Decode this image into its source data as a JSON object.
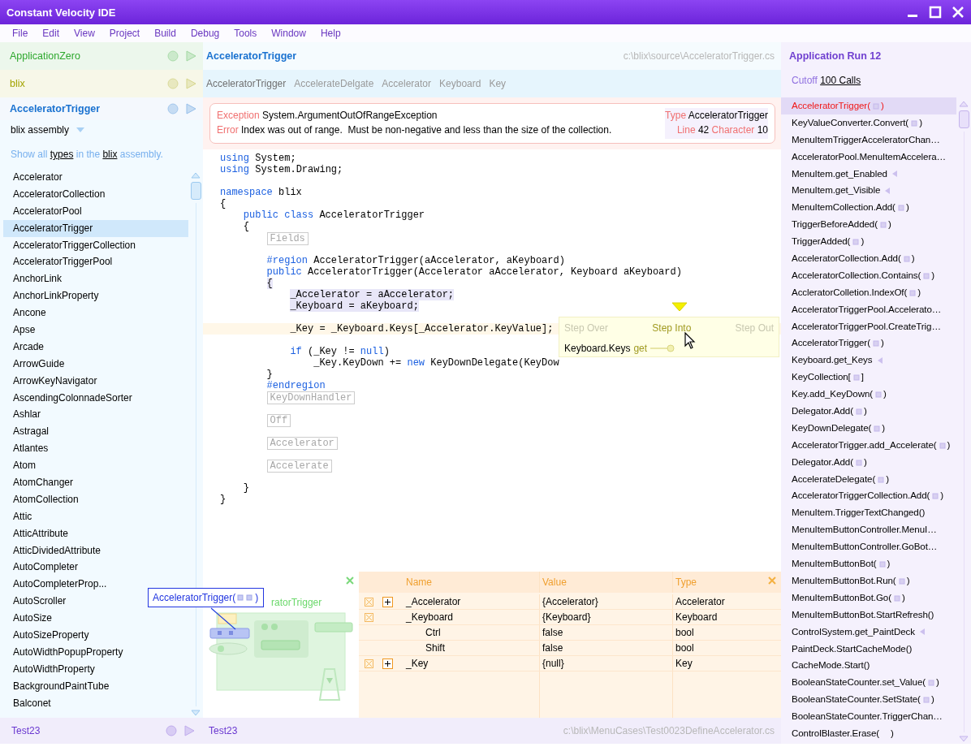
{
  "window": {
    "title": "Constant Velocity IDE"
  },
  "menu": [
    "File",
    "Edit",
    "View",
    "Project",
    "Build",
    "Debug",
    "Tools",
    "Window",
    "Help"
  ],
  "projects": [
    {
      "name": "ApplicationZero",
      "color": "#2ea82e",
      "selected": false
    },
    {
      "name": "blix",
      "color": "#a3a300",
      "selected": false
    },
    {
      "name": "AcceleratorTrigger",
      "color": "#1a72d0",
      "selected": true
    }
  ],
  "assembly": {
    "label": "blix assembly"
  },
  "assembly_hint": [
    {
      "text": "Show all "
    },
    {
      "text": "types",
      "link": true
    },
    {
      "text": " in the "
    },
    {
      "text": "blix",
      "link": true
    },
    {
      "text": " assembly."
    }
  ],
  "types": [
    {
      "name": "Accelerator",
      "selected": false
    },
    {
      "name": "AcceleratorCollection",
      "selected": false
    },
    {
      "name": "AcceleratorPool",
      "selected": false
    },
    {
      "name": "AcceleratorTrigger",
      "selected": true
    },
    {
      "name": "AcceleratorTriggerCollection",
      "selected": false
    },
    {
      "name": "AcceleratorTriggerPool",
      "selected": false
    },
    {
      "name": "AnchorLink",
      "selected": false
    },
    {
      "name": "AnchorLinkProperty",
      "selected": false
    },
    {
      "name": "Ancone",
      "selected": false
    },
    {
      "name": "Apse",
      "selected": false
    },
    {
      "name": "Arcade",
      "selected": false
    },
    {
      "name": "ArrowGuide",
      "selected": false
    },
    {
      "name": "ArrowKeyNavigator",
      "selected": false
    },
    {
      "name": "AscendingColonnadeSorter",
      "selected": false
    },
    {
      "name": "Ashlar",
      "selected": false
    },
    {
      "name": "Astragal",
      "selected": false
    },
    {
      "name": "Atlantes",
      "selected": false
    },
    {
      "name": "Atom",
      "selected": false
    },
    {
      "name": "AtomChanger",
      "selected": false
    },
    {
      "name": "AtomCollection",
      "selected": false
    },
    {
      "name": "Attic",
      "selected": false
    },
    {
      "name": "AtticAttribute",
      "selected": false
    },
    {
      "name": "AtticDividedAttribute",
      "selected": false
    },
    {
      "name": "AutoCompleter",
      "selected": false
    },
    {
      "name": "AutoCompleterProp...",
      "selected": false
    },
    {
      "name": "AutoScroller",
      "selected": false
    },
    {
      "name": "AutoSize",
      "selected": false
    },
    {
      "name": "AutoSizeProperty",
      "selected": false
    },
    {
      "name": "AutoWidthPopupProperty",
      "selected": false
    },
    {
      "name": "AutoWidthProperty",
      "selected": false
    },
    {
      "name": "BackgroundPaintTube",
      "selected": false
    },
    {
      "name": "Balconet",
      "selected": false
    }
  ],
  "left_footer": {
    "name": "Test23"
  },
  "editor": {
    "title": "AcceleratorTrigger",
    "path": "c:\\blix\\source\\AcceleratorTrigger.cs",
    "breadcrumbs": [
      {
        "label": "AcceleratorTrigger",
        "selected": true
      },
      {
        "label": "AccelerateDelgate",
        "selected": false
      },
      {
        "label": "Accelerator",
        "selected": false
      },
      {
        "label": "Keyboard",
        "selected": false
      },
      {
        "label": "Key",
        "selected": false
      }
    ],
    "exception": {
      "exception_label": "Exception",
      "exception": "System.ArgumentOutOfRangeException",
      "error_label": "Error",
      "error": "Index was out of range.  Must be non-negative and less than the size of the collection.",
      "type_label": "Type",
      "type": "AcceleratorTrigger",
      "line_label": "Line",
      "line": "42",
      "character_label": "Character",
      "character": "10"
    },
    "code": [
      {
        "kind": "code",
        "selected": false,
        "current": false,
        "tokens": [
          {
            "t": "using",
            "kw": true
          },
          {
            "t": " System;"
          }
        ]
      },
      {
        "kind": "code",
        "selected": false,
        "current": false,
        "tokens": [
          {
            "t": "using",
            "kw": true
          },
          {
            "t": " System.Drawing;"
          }
        ]
      },
      {
        "kind": "blank"
      },
      {
        "kind": "code",
        "selected": false,
        "current": false,
        "tokens": [
          {
            "t": "namespace",
            "kw": true
          },
          {
            "t": " blix"
          }
        ]
      },
      {
        "kind": "code",
        "selected": false,
        "current": false,
        "tokens": [
          {
            "t": "{"
          }
        ],
        "children": [
          {
            "kind": "code",
            "selected": false,
            "current": false,
            "tokens": [
              {
                "t": "public class",
                "kw": true
              },
              {
                "t": " AcceleratorTrigger"
              }
            ]
          },
          {
            "kind": "code",
            "selected": false,
            "current": false,
            "tokens": [
              {
                "t": "{"
              }
            ],
            "children": [
              {
                "kind": "fold",
                "label": "Fields"
              },
              {
                "kind": "code",
                "selected": false,
                "current": false,
                "tokens": [
                  {
                    "t": "#region",
                    "kw": true
                  },
                  {
                    "t": " AcceleratorTrigger(aAccelerator, aKeyboard)"
                  }
                ]
              },
              {
                "kind": "code",
                "selected": false,
                "current": false,
                "tokens": [
                  {
                    "t": "public",
                    "kw": true
                  },
                  {
                    "t": " AcceleratorTrigger(Accelerator aAccelerator, Keyboard aKeyboard)"
                  }
                ]
              },
              {
                "kind": "code",
                "selected": true,
                "current": false,
                "tokens": [
                  {
                    "t": "{"
                  }
                ],
                "children": [
                  {
                    "kind": "code",
                    "selected": true,
                    "current": false,
                    "tokens": [
                      {
                        "t": "_Accelerator = aAccelerator;"
                      }
                    ]
                  },
                  {
                    "kind": "code",
                    "selected": true,
                    "current": false,
                    "tokens": [
                      {
                        "t": "_Keyboard = aKeyboard;"
                      }
                    ]
                  },
                  {
                    "kind": "blank"
                  },
                  {
                    "kind": "code",
                    "selected": false,
                    "current": true,
                    "tokens": [
                      {
                        "t": "_Key = _Keyboard.Keys[_Accelerator.KeyValue];"
                      }
                    ]
                  },
                  {
                    "kind": "blank"
                  },
                  {
                    "kind": "code",
                    "selected": false,
                    "current": false,
                    "tokens": [
                      {
                        "t": "if",
                        "kw": true
                      },
                      {
                        "t": " (_Key != "
                      },
                      {
                        "t": "null",
                        "kw": true
                      },
                      {
                        "t": ")"
                      }
                    ],
                    "children": [
                      {
                        "kind": "code",
                        "selected": false,
                        "current": false,
                        "tokens": [
                          {
                            "t": "_Key.KeyDown += "
                          },
                          {
                            "t": "new",
                            "kw": true
                          },
                          {
                            "t": " KeyDownDelegate(KeyDow"
                          }
                        ]
                      }
                    ]
                  }
                ]
              },
              {
                "kind": "code",
                "selected": false,
                "current": false,
                "tokens": [
                  {
                    "t": "}"
                  }
                ]
              },
              {
                "kind": "code",
                "selected": false,
                "current": false,
                "tokens": [
                  {
                    "t": "#endregion",
                    "kw": true
                  }
                ]
              },
              {
                "kind": "fold",
                "label": "KeyDownHandler"
              },
              {
                "kind": "fold",
                "label": "Off"
              },
              {
                "kind": "fold",
                "label": "Accelerator"
              },
              {
                "kind": "fold",
                "label": "Accelerate"
              }
            ]
          },
          {
            "kind": "code",
            "selected": false,
            "current": false,
            "tokens": [
              {
                "t": "}"
              }
            ]
          }
        ]
      },
      {
        "kind": "code",
        "selected": false,
        "current": false,
        "tokens": [
          {
            "t": "}"
          }
        ]
      }
    ]
  },
  "debug_popup": {
    "steps": [
      {
        "label": "Step Over",
        "selected": false
      },
      {
        "label": "Step Into",
        "selected": true
      },
      {
        "label": "Step Out",
        "selected": false
      }
    ],
    "member": "Keyboard.Keys",
    "accessor": "get"
  },
  "diagram": {
    "label": "ratorTrigger",
    "callout": "AcceleratorTrigger(",
    "callout_close": ")"
  },
  "variables": {
    "columns": [
      "Name",
      "Value",
      "Type"
    ],
    "rows": [
      {
        "name": "_Accelerator",
        "value": "{Accelerator}",
        "type": "Accelerator",
        "expanded": false
      },
      {
        "name": "_Keyboard",
        "value": "{Keyboard}",
        "type": "Keyboard",
        "expanded": true,
        "children": [
          {
            "name": "Ctrl",
            "value": "false",
            "type": "bool"
          },
          {
            "name": "Shift",
            "value": "false",
            "type": "bool"
          }
        ]
      },
      {
        "name": "_Key",
        "value": "{null}",
        "type": "Key",
        "expanded": false
      }
    ]
  },
  "editor_footer": {
    "name": "Test23",
    "path": "c:\\blix\\MenuCases\\Test0023DefineAccelerator.cs"
  },
  "run": {
    "title": "Application Run 12",
    "cutoff_label": "Cutoff",
    "cutoff": "100 Calls",
    "calls": [
      {
        "kind": "args",
        "name": "AcceleratorTrigger(",
        "close": ")",
        "selected": true
      },
      {
        "kind": "args",
        "name": "KeyValueConverter.Convert(",
        "close": ")",
        "selected": false
      },
      {
        "kind": "plain",
        "name": "MenuItemTriggerAcceleratorChan…",
        "selected": false
      },
      {
        "kind": "plain",
        "name": "AcceleratorPool.MenuItemAccelera…",
        "selected": false
      },
      {
        "kind": "getter",
        "name": "MenuItem.get_Enabled",
        "selected": false
      },
      {
        "kind": "getter",
        "name": "MenuItem.get_Visible",
        "selected": false
      },
      {
        "kind": "args",
        "name": "MenuItemCollection.Add(",
        "close": ")",
        "selected": false
      },
      {
        "kind": "args",
        "name": "TriggerBeforeAdded(",
        "close": ")",
        "selected": false
      },
      {
        "kind": "args",
        "name": "TriggerAdded(",
        "close": ")",
        "selected": false
      },
      {
        "kind": "args",
        "name": "AcceleratorCollection.Add(",
        "close": ")",
        "selected": false
      },
      {
        "kind": "args",
        "name": "AcceleratorCollection.Contains(",
        "close": ")",
        "selected": false
      },
      {
        "kind": "args",
        "name": "AccleratorColletion.IndexOf(",
        "close": ")",
        "selected": false
      },
      {
        "kind": "plain",
        "name": "AcceleratorTriggerPool.Accelerato…",
        "selected": false
      },
      {
        "kind": "plain",
        "name": "AcceleratorTriggerPool.CreateTrig…",
        "selected": false
      },
      {
        "kind": "args",
        "name": "AcceleratorTrigger(",
        "close": ")",
        "selected": false
      },
      {
        "kind": "getter",
        "name": "Keyboard.get_Keys",
        "selected": false
      },
      {
        "kind": "args",
        "name": "KeyCollection[",
        "close": "]",
        "selected": false
      },
      {
        "kind": "args",
        "name": "Key.add_KeyDown(",
        "close": ")",
        "selected": false
      },
      {
        "kind": "args",
        "name": "Delegator.Add(",
        "close": ")",
        "selected": false
      },
      {
        "kind": "args",
        "name": "KeyDownDelegate(",
        "close": ")",
        "selected": false
      },
      {
        "kind": "args",
        "name": "AcceleratorTrigger.add_Accelerate(",
        "close": ")",
        "selected": false
      },
      {
        "kind": "args",
        "name": "Delegator.Add(",
        "close": ")",
        "selected": false
      },
      {
        "kind": "args",
        "name": "AccelerateDelegate(",
        "close": ")",
        "selected": false
      },
      {
        "kind": "args",
        "name": "AcceleratorTriggerCollection.Add(",
        "close": ")",
        "selected": false
      },
      {
        "kind": "plain",
        "name": "MenuItem.TriggerTextChanged()",
        "selected": false
      },
      {
        "kind": "plain",
        "name": "MenuItemButtonController.MenuI…",
        "selected": false
      },
      {
        "kind": "plain",
        "name": "MenuItemButtonController.GoBot…",
        "selected": false
      },
      {
        "kind": "args",
        "name": "MenuItemButtonBot(",
        "close": ")",
        "selected": false
      },
      {
        "kind": "args",
        "name": "MenuItemButtonBot.Run(",
        "close": ")",
        "selected": false
      },
      {
        "kind": "args",
        "name": "MenuItemButtonBot.Go(",
        "close": ")",
        "selected": false
      },
      {
        "kind": "plain",
        "name": "MenuItemButtonBot.StartRefresh()",
        "selected": false
      },
      {
        "kind": "getter",
        "name": "ControlSystem.get_PaintDeck",
        "selected": false
      },
      {
        "kind": "plain",
        "name": "PaintDeck.StartCacheMode()",
        "selected": false
      },
      {
        "kind": "plain",
        "name": "CacheMode.Start()",
        "selected": false
      },
      {
        "kind": "args",
        "name": "BooleanStateCounter.set_Value(",
        "close": ")",
        "selected": false
      },
      {
        "kind": "args",
        "name": "BooleanStateCounter.SetState(",
        "close": ")",
        "selected": false
      },
      {
        "kind": "plain",
        "name": "BooleanStateCounter.TriggerChan…",
        "selected": false
      },
      {
        "kind": "empty",
        "name": "ControlBlaster.Erase(",
        "close": ")",
        "selected": false
      }
    ]
  }
}
